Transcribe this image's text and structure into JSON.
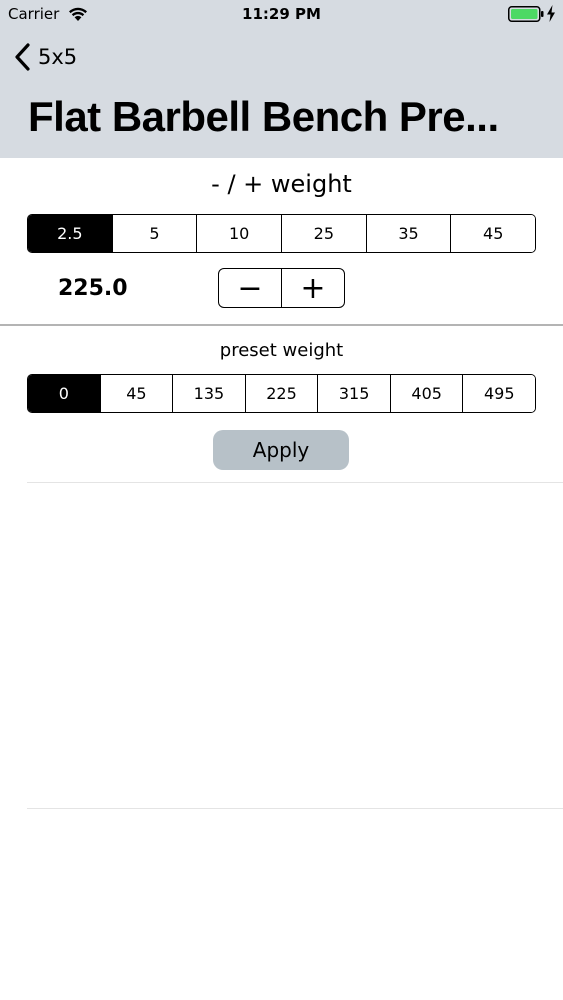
{
  "status_bar": {
    "carrier": "Carrier",
    "time": "11:29 PM",
    "battery_color": "#4cd964"
  },
  "nav": {
    "back_label": "5x5",
    "title": "Flat Barbell Bench Pre..."
  },
  "weight_step": {
    "title": "- / + weight",
    "options": [
      "2.5",
      "5",
      "10",
      "25",
      "35",
      "45"
    ],
    "selected": "2.5"
  },
  "current": {
    "weight": "225.0",
    "minus": "−",
    "plus": "+"
  },
  "preset": {
    "title": "preset weight",
    "options": [
      "0",
      "45",
      "135",
      "225",
      "315",
      "405",
      "495"
    ],
    "selected": "0",
    "apply_label": "Apply"
  },
  "colors": {
    "header_bg": "#d6dbe1",
    "apply_bg": "#b7c1c8",
    "selected_bg": "#000000"
  }
}
